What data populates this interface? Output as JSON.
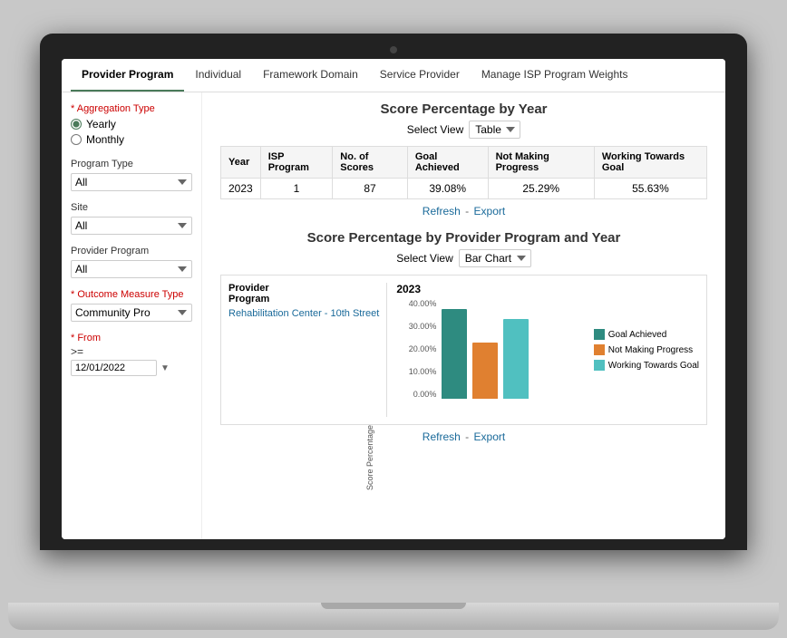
{
  "nav": {
    "tabs": [
      {
        "label": "Provider Program",
        "active": true
      },
      {
        "label": "Individual",
        "active": false
      },
      {
        "label": "Framework Domain",
        "active": false
      },
      {
        "label": "Service Provider",
        "active": false
      },
      {
        "label": "Manage ISP Program Weights",
        "active": false
      }
    ]
  },
  "sidebar": {
    "aggregation_label": "* Aggregation Type",
    "aggregation_options": [
      {
        "label": "Yearly",
        "value": "yearly",
        "checked": true
      },
      {
        "label": "Monthly",
        "value": "monthly",
        "checked": false
      }
    ],
    "program_type_label": "Program Type",
    "program_type_value": "All",
    "site_label": "Site",
    "site_value": "All",
    "provider_program_label": "Provider Program",
    "provider_program_value": "All",
    "outcome_measure_label": "* Outcome Measure Type",
    "outcome_measure_value": "Community Pro",
    "from_label": "* From",
    "from_operator": ">=",
    "from_date": "12/01/2022"
  },
  "score_by_year": {
    "title": "Score Percentage by Year",
    "select_view_label": "Select View",
    "select_view_value": "Table",
    "table": {
      "headers": [
        "Year",
        "ISP Program",
        "No. of Scores",
        "Goal Achieved",
        "Not Making Progress",
        "Working Towards Goal"
      ],
      "rows": [
        {
          "year": "2023",
          "isp_program": "1",
          "no_scores": "87",
          "goal_achieved": "39.08%",
          "not_making_progress": "25.29%",
          "working_towards_goal": "55.63%"
        }
      ]
    },
    "refresh_label": "Refresh",
    "export_label": "Export"
  },
  "score_by_program": {
    "title": "Score Percentage by Provider Program and Year",
    "select_view_label": "Select View",
    "select_view_value": "Bar Chart",
    "provider_program_header": "Provider\nProgram",
    "provider_link": "Rehabilitation Center - 10th Street",
    "year": "2023",
    "y_axis_labels": [
      "40.00%",
      "30.00%",
      "20.00%",
      "10.00%",
      "0.00%"
    ],
    "x_axis_label": "Score Percentage",
    "bars": [
      {
        "label": "Goal Achieved",
        "color": "teal",
        "height_pct": 90,
        "value": 0.39
      },
      {
        "label": "Not Making Progress",
        "color": "orange",
        "height_pct": 55,
        "value": 0.25
      },
      {
        "label": "Working Towards Goal",
        "color": "cyan",
        "height_pct": 85,
        "value": 0.35
      }
    ],
    "legend": [
      {
        "label": "Goal Achieved",
        "color": "#2e8b80"
      },
      {
        "label": "Not Making Progress",
        "color": "#e08030"
      },
      {
        "label": "Working Towards Goal",
        "color": "#50c0c0"
      }
    ],
    "refresh_label": "Refresh",
    "export_label": "Export"
  }
}
